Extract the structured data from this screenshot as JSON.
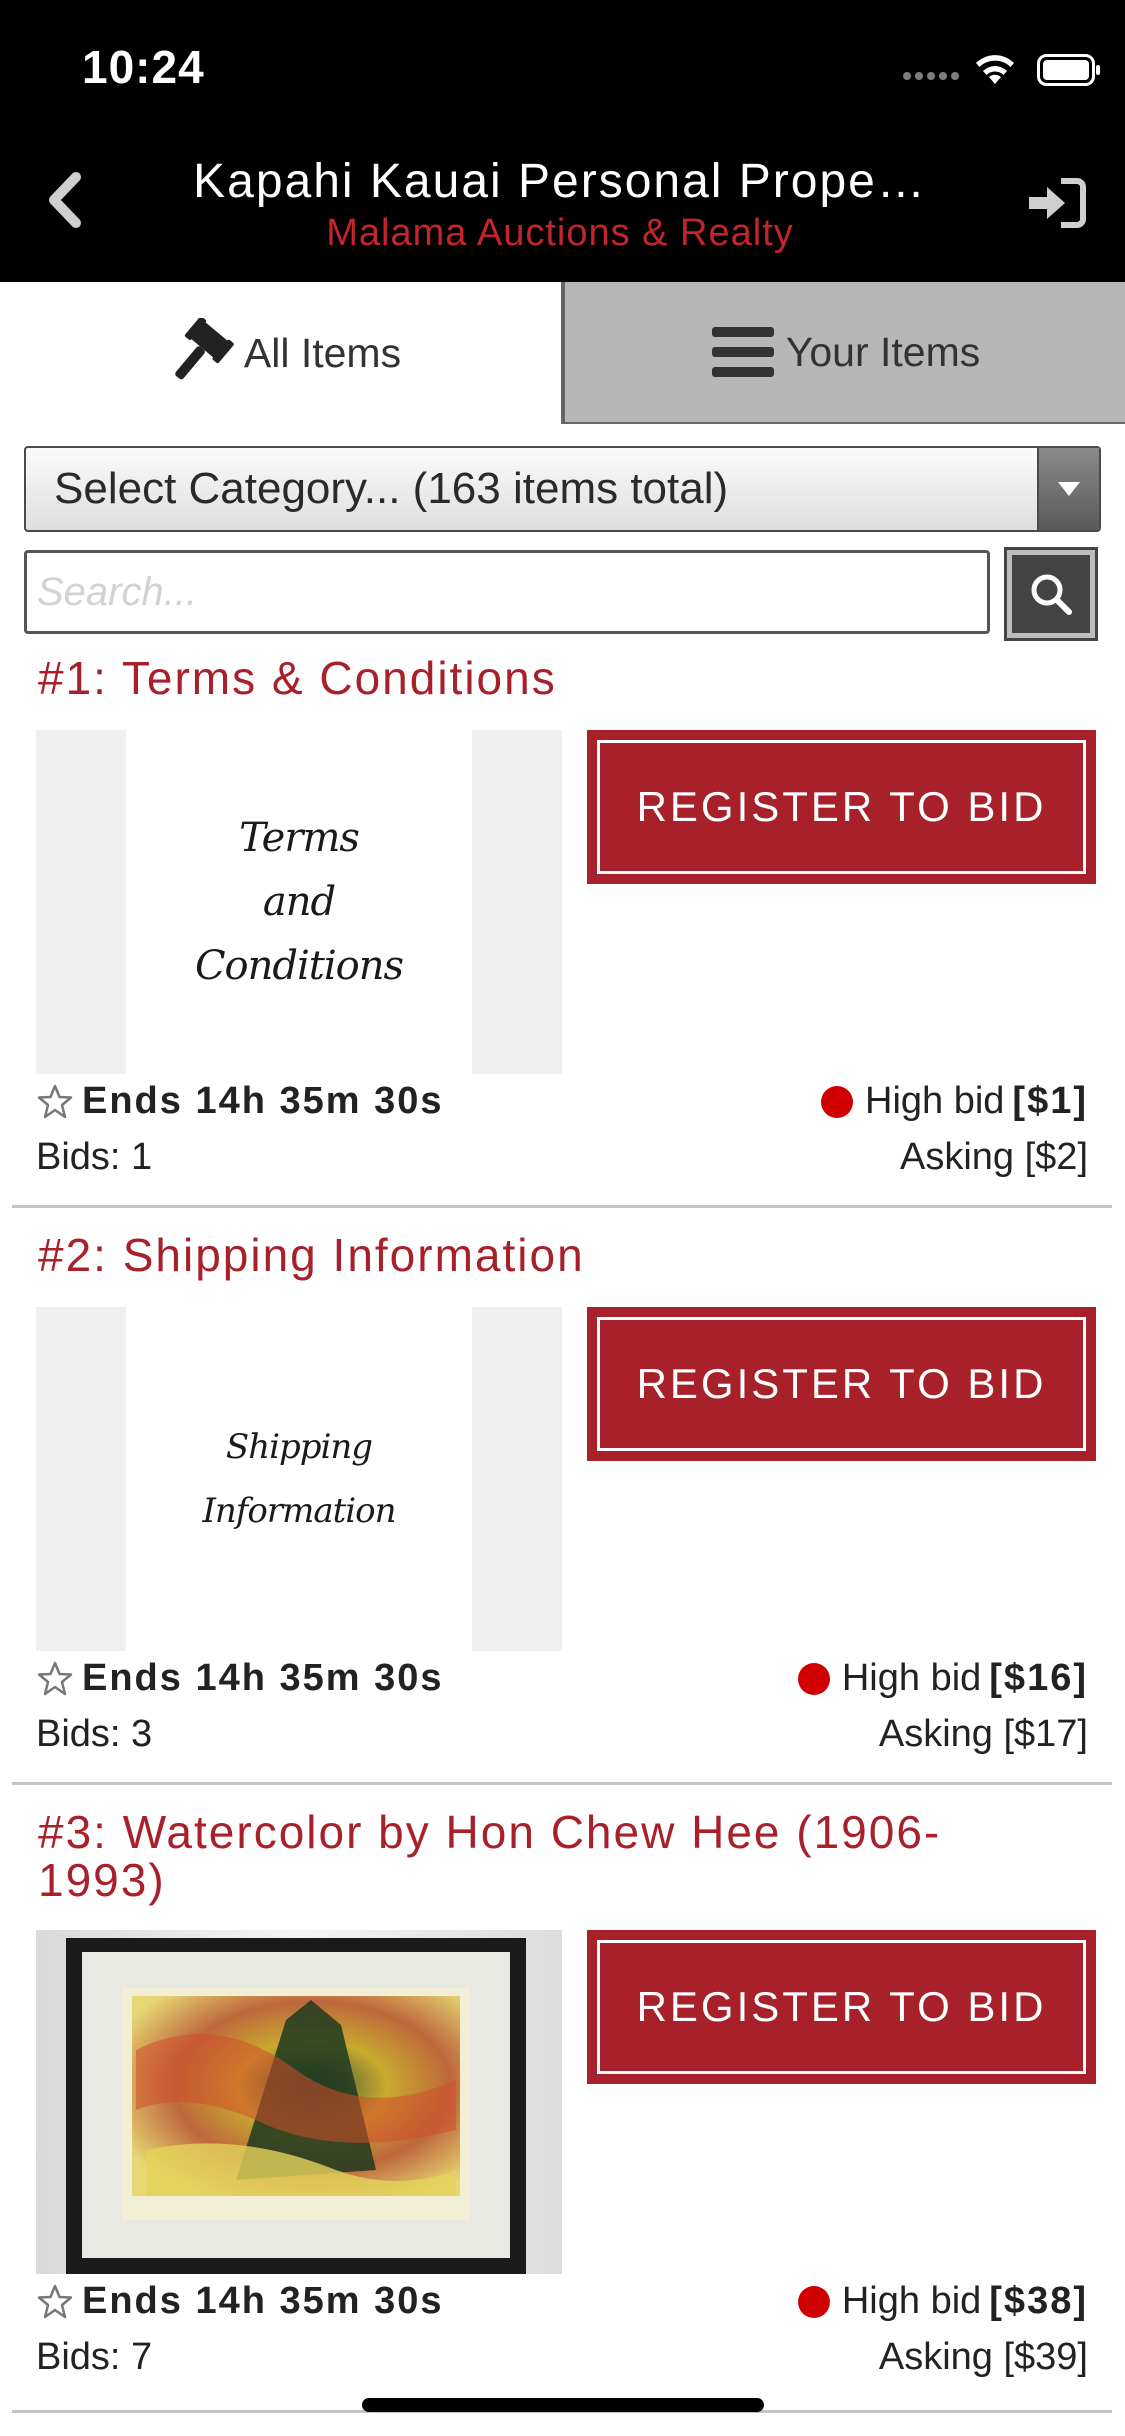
{
  "status_bar": {
    "time": "10:24"
  },
  "header": {
    "title": "Kapahi Kauai Personal Prope…",
    "subtitle": "Malama Auctions & Realty"
  },
  "tabs": [
    {
      "label": "All Items",
      "icon": "gavel-icon",
      "active": true
    },
    {
      "label": "Your Items",
      "icon": "menu-icon",
      "active": false
    }
  ],
  "category": {
    "selected": "Select Category... (163 items total)"
  },
  "search": {
    "placeholder": "Search..."
  },
  "lots": [
    {
      "title": "#1: Terms & Conditions",
      "image_text": [
        "Terms",
        "and",
        "Conditions"
      ],
      "button": "REGISTER TO BID",
      "ends": "Ends 14h 35m 30s",
      "high_bid_label": "High bid",
      "high_bid": "[$1]",
      "bids": "Bids: 1",
      "asking": "Asking [$2]"
    },
    {
      "title": "#2: Shipping Information",
      "image_text": [
        "Shipping Information"
      ],
      "button": "REGISTER TO BID",
      "ends": "Ends 14h 35m 30s",
      "high_bid_label": "High bid",
      "high_bid": "[$16]",
      "bids": "Bids: 3",
      "asking": "Asking [$17]"
    },
    {
      "title": "#3: Watercolor by Hon Chew Hee (1906-1993)",
      "button": "REGISTER TO BID",
      "ends": "Ends 14h 35m 30s",
      "high_bid_label": "High bid",
      "high_bid": "[$38]",
      "bids": "Bids: 7",
      "asking": "Asking [$39]"
    }
  ],
  "colors": {
    "brand_red": "#a8202a",
    "subtitle_red": "#c4242b",
    "status_dot": "#d10000",
    "header_bg": "#000000"
  }
}
